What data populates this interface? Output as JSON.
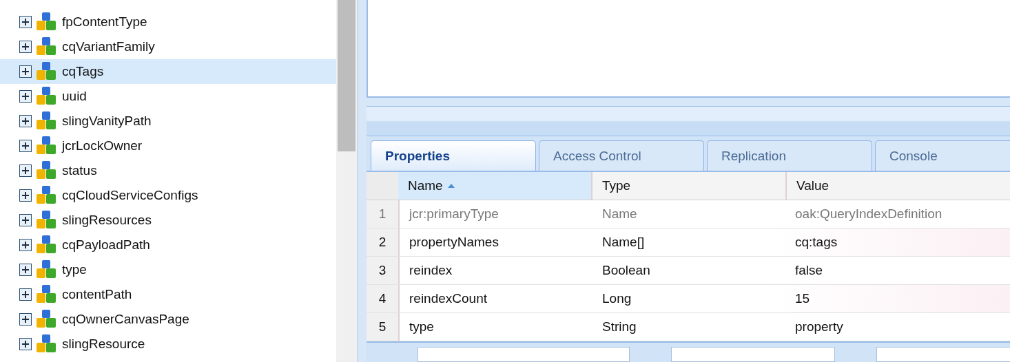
{
  "tree": {
    "items": [
      {
        "label": "fpContentType",
        "selected": false
      },
      {
        "label": "cqVariantFamily",
        "selected": false
      },
      {
        "label": "cqTags",
        "selected": true
      },
      {
        "label": "uuid",
        "selected": false
      },
      {
        "label": "slingVanityPath",
        "selected": false
      },
      {
        "label": "jcrLockOwner",
        "selected": false
      },
      {
        "label": "status",
        "selected": false
      },
      {
        "label": "cqCloudServiceConfigs",
        "selected": false
      },
      {
        "label": "slingResources",
        "selected": false
      },
      {
        "label": "cqPayloadPath",
        "selected": false
      },
      {
        "label": "type",
        "selected": false
      },
      {
        "label": "contentPath",
        "selected": false
      },
      {
        "label": "cqOwnerCanvasPage",
        "selected": false
      },
      {
        "label": "slingResource",
        "selected": false
      }
    ]
  },
  "tabs": [
    {
      "label": "Properties",
      "selected": true
    },
    {
      "label": "Access Control",
      "selected": false
    },
    {
      "label": "Replication",
      "selected": false
    },
    {
      "label": "Console",
      "selected": false
    }
  ],
  "table": {
    "columns": [
      {
        "label": "Name",
        "sorted": true
      },
      {
        "label": "Type",
        "sorted": false
      },
      {
        "label": "Value",
        "sorted": false
      }
    ],
    "rows": [
      {
        "index": "1",
        "name": "jcr:primaryType",
        "type": "Name",
        "value": "oak:QueryIndexDefinition",
        "protected": true
      },
      {
        "index": "2",
        "name": "propertyNames",
        "type": "Name[]",
        "value": "cq:tags",
        "protected": false
      },
      {
        "index": "3",
        "name": "reindex",
        "type": "Boolean",
        "value": "false",
        "protected": false
      },
      {
        "index": "4",
        "name": "reindexCount",
        "type": "Long",
        "value": "15",
        "protected": false
      },
      {
        "index": "5",
        "name": "type",
        "type": "String",
        "value": "property",
        "protected": false
      }
    ]
  }
}
